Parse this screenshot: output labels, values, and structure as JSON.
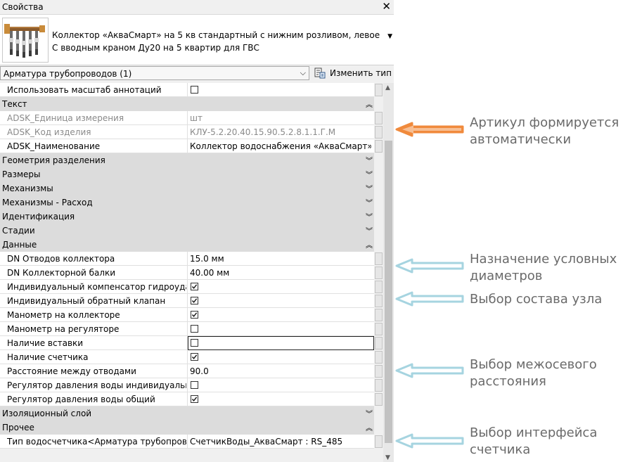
{
  "panel": {
    "title": "Свойства",
    "type_name_line1": "Коллектор «АкваСмарт» на 5 кв стандартный с нижним розливом, левое подк...",
    "type_name_line2": "С вводным краном Ду20 на 5 квартир для ГВС",
    "selector_value": "Арматура трубопроводов (1)",
    "edit_type_label": "Изменить тип"
  },
  "rows": [
    {
      "kind": "prop",
      "name": "Использовать масштаб аннотаций",
      "checkbox": true,
      "checked": false
    },
    {
      "kind": "group",
      "name": "Текст",
      "expanded": true
    },
    {
      "kind": "prop",
      "name": "ADSK_Единица измерения",
      "value": "шт",
      "disabled": true
    },
    {
      "kind": "prop",
      "name": "ADSK_Код изделия",
      "value": "КЛУ-5.2.20.40.15.90.5.2.8.1.1.Г.М",
      "disabled": true
    },
    {
      "kind": "prop",
      "name": "ADSK_Наименование",
      "value": "Коллектор водоснабжения «АкваСмарт» ..."
    },
    {
      "kind": "group",
      "name": "Геометрия разделения",
      "expanded": false
    },
    {
      "kind": "group",
      "name": "Размеры",
      "expanded": false
    },
    {
      "kind": "group",
      "name": "Механизмы",
      "expanded": false
    },
    {
      "kind": "group",
      "name": "Механизмы - Расход",
      "expanded": false
    },
    {
      "kind": "group",
      "name": "Идентификация",
      "expanded": false
    },
    {
      "kind": "group",
      "name": "Стадии",
      "expanded": false
    },
    {
      "kind": "group",
      "name": "Данные",
      "expanded": true
    },
    {
      "kind": "prop",
      "name": "DN Отводов коллектора",
      "value": "15.0 мм"
    },
    {
      "kind": "prop",
      "name": "DN Коллекторной балки",
      "value": "40.00 мм"
    },
    {
      "kind": "prop",
      "name": "Индивидуальный компенсатор гидроуда...",
      "checkbox": true,
      "checked": true
    },
    {
      "kind": "prop",
      "name": "Индивидуальный обратный клапан",
      "checkbox": true,
      "checked": true
    },
    {
      "kind": "prop",
      "name": "Манометр на коллекторе",
      "checkbox": true,
      "checked": true
    },
    {
      "kind": "prop",
      "name": "Манометр на регуляторе",
      "checkbox": true,
      "checked": false
    },
    {
      "kind": "prop",
      "name": "Наличие вставки",
      "checkbox": true,
      "checked": false,
      "focused": true
    },
    {
      "kind": "prop",
      "name": "Наличие счетчика",
      "checkbox": true,
      "checked": true
    },
    {
      "kind": "prop",
      "name": "Расстояние между отводами",
      "value": "90.0"
    },
    {
      "kind": "prop",
      "name": "Регулятор давления воды индивидуальн...",
      "checkbox": true,
      "checked": false
    },
    {
      "kind": "prop",
      "name": "Регулятор давления воды общий",
      "checkbox": true,
      "checked": true
    },
    {
      "kind": "group",
      "name": "Изоляционный слой",
      "expanded": false
    },
    {
      "kind": "group",
      "name": "Прочее",
      "expanded": true
    },
    {
      "kind": "prop",
      "name": "Тип водосчетчика<Арматура трубопров...",
      "value": "СчетчикВоды_АкваСмарт : RS_485"
    }
  ],
  "annotations": [
    {
      "line1": "Артикул формируется",
      "line2": "автоматически",
      "arrow_color": "#f08a3c"
    },
    {
      "line1": "Назначение условных",
      "line2": "диаметров",
      "arrow_color": "#a6d4e0"
    },
    {
      "line1": "Выбор состава узла",
      "line2": "",
      "arrow_color": "#a6d4e0"
    },
    {
      "line1": "Выбор межосевого",
      "line2": "расстояния",
      "arrow_color": "#a6d4e0"
    },
    {
      "line1": "Выбор интерфейса",
      "line2": "счетчика",
      "arrow_color": "#a6d4e0"
    }
  ],
  "icons": {
    "close": "close-icon",
    "dropdown": "chevron-down-icon",
    "edit_type": "edit-type-icon",
    "collapse": "double-chevron-up-icon",
    "expand": "double-chevron-down-icon"
  }
}
